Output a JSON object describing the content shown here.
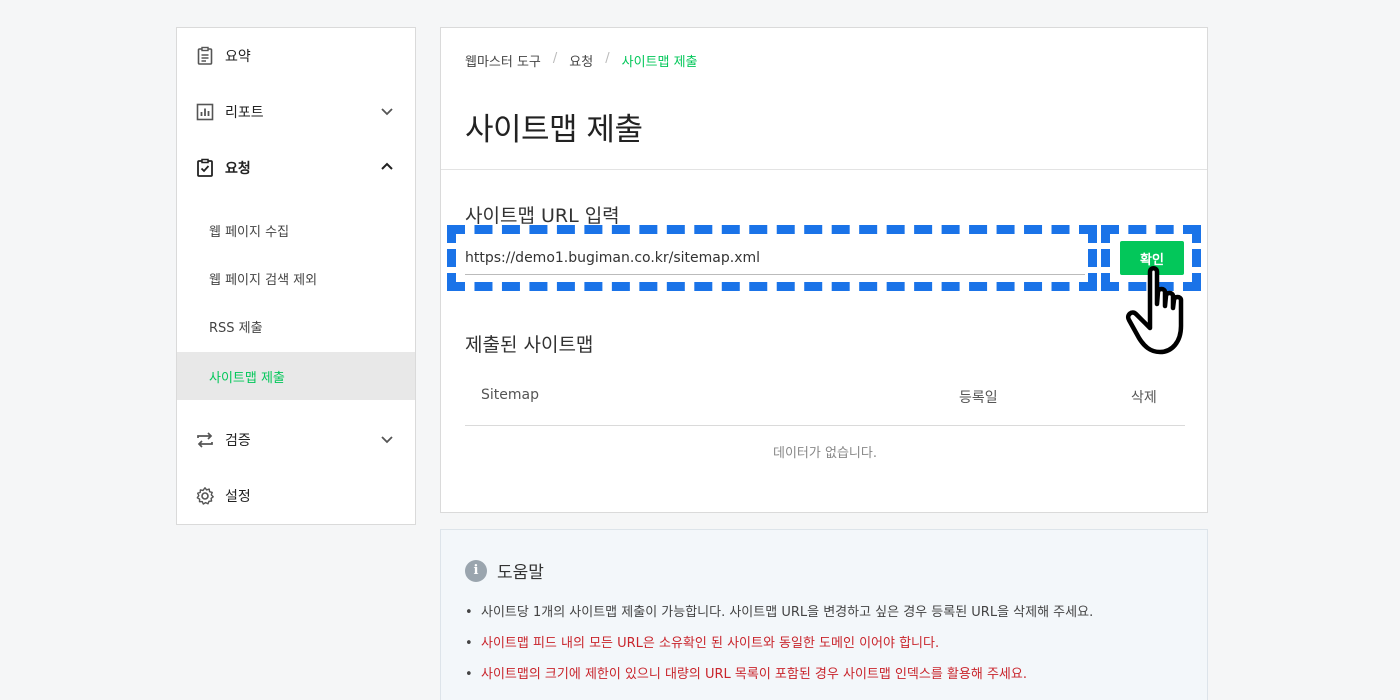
{
  "sidebar": {
    "summary": "요약",
    "report": "리포트",
    "request": "요청",
    "sub_items": [
      "웹 페이지 수집",
      "웹 페이지 검색 제외",
      "RSS 제출",
      "사이트맵 제출"
    ],
    "verify": "검증",
    "settings": "설정"
  },
  "breadcrumb": [
    "웹마스터 도구",
    "요청",
    "사이트맵 제출"
  ],
  "page_title": "사이트맵 제출",
  "url_section": {
    "label": "사이트맵 URL 입력",
    "input_value": "https://demo1.bugiman.co.kr/sitemap.xml",
    "button_label": "확인"
  },
  "submitted": {
    "label": "제출된 사이트맵",
    "columns": [
      "Sitemap",
      "등록일",
      "삭제"
    ],
    "empty_message": "데이터가 없습니다."
  },
  "help": {
    "title": "도움말",
    "items": [
      "사이트당 1개의 사이트맵 제출이 가능합니다. 사이트맵 URL을 변경하고 싶은 경우 등록된 URL을 삭제해 주세요.",
      "사이트맵 피드 내의 모든 URL은 소유확인 된 사이트와 동일한 도메인 이어야 합니다.",
      "사이트맵의 크기에 제한이 있으니 대량의 URL 목록이 포함된 경우 사이트맵 인덱스를 활용해 주세요."
    ]
  },
  "colors": {
    "accent": "#03c75a",
    "highlight": "#1a73e8",
    "warning": "#c9252c"
  }
}
